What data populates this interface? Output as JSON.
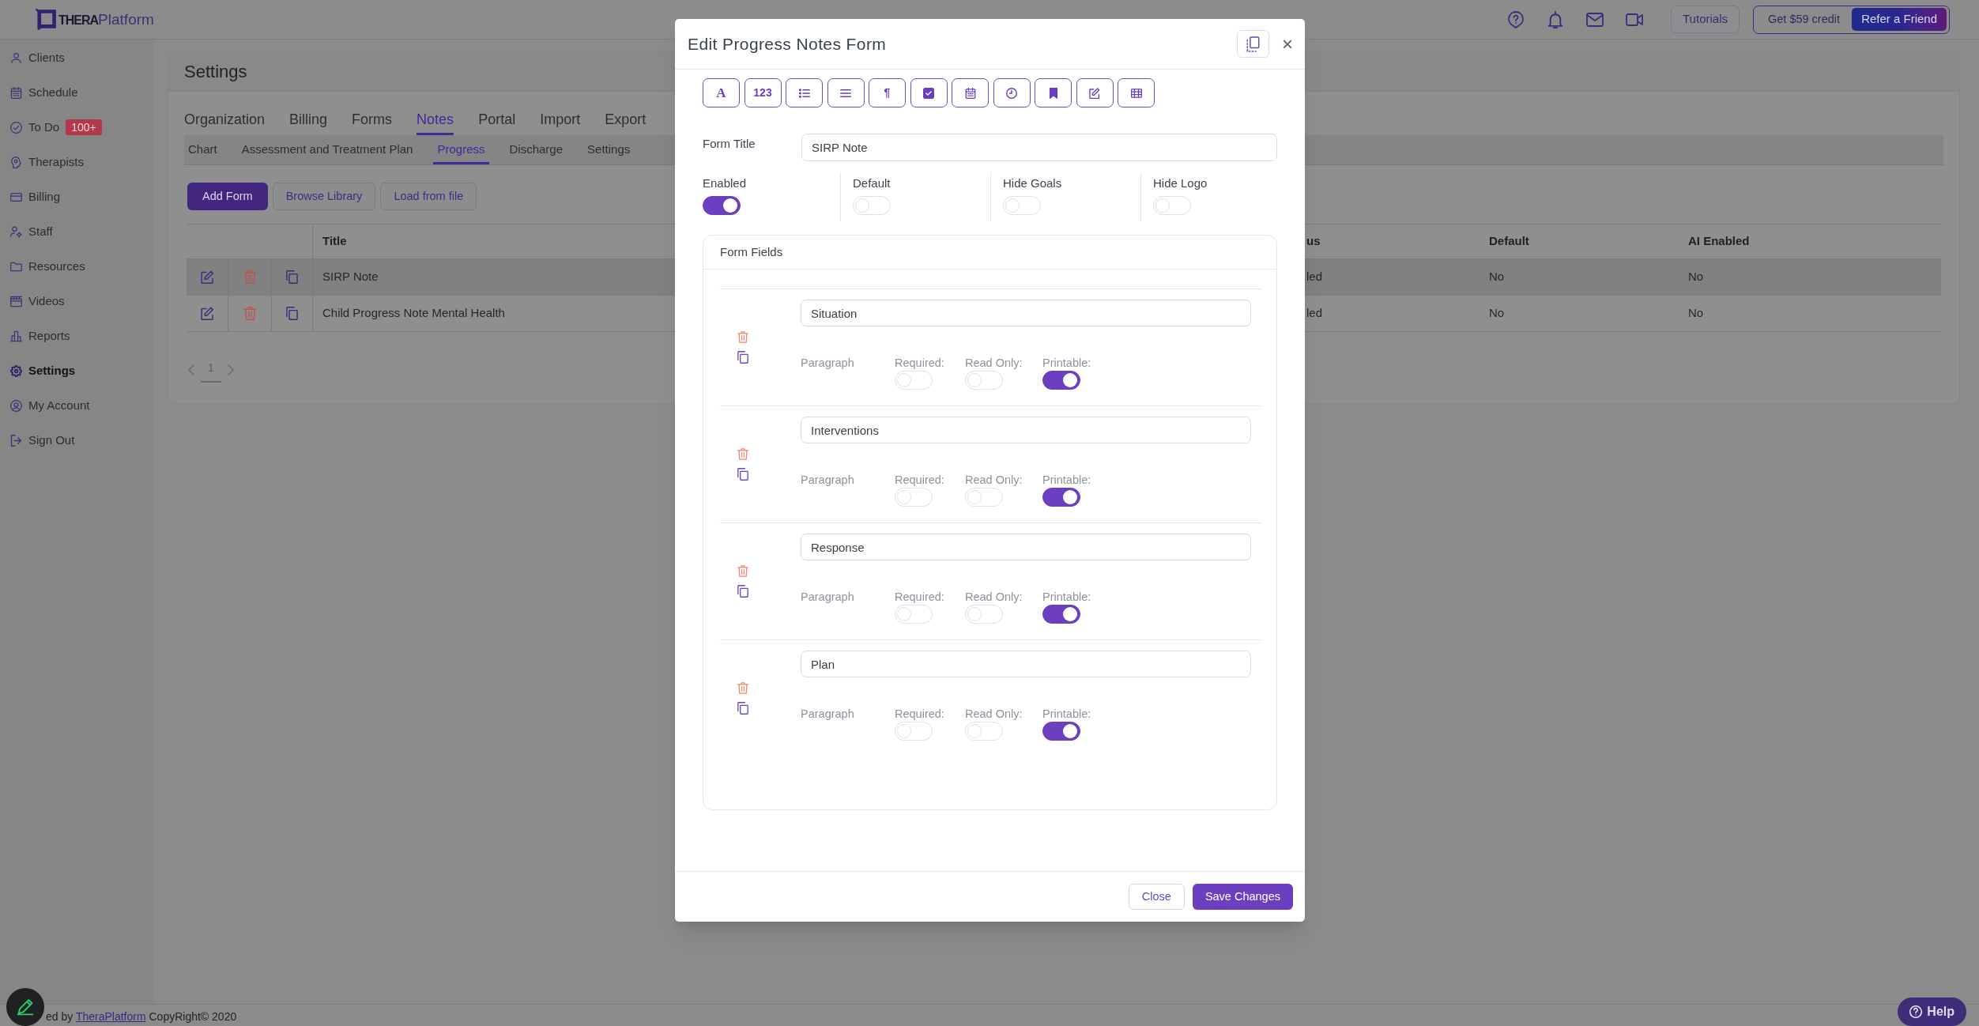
{
  "header": {
    "logo": {
      "bold": "THERA",
      "light": "Platform"
    },
    "buttons": [
      {
        "label": "Tutorials"
      }
    ],
    "credit": {
      "label": "Get $59 credit",
      "button": "Refer a Friend"
    }
  },
  "sidebar": {
    "items": [
      {
        "label": "Clients",
        "selected": false
      },
      {
        "label": "Schedule",
        "selected": false
      },
      {
        "label": "To Do",
        "selected": false,
        "badge": "100+"
      },
      {
        "label": "Therapists",
        "selected": false
      },
      {
        "label": "Billing",
        "selected": false
      },
      {
        "label": "Staff",
        "selected": false
      },
      {
        "label": "Resources",
        "selected": false
      },
      {
        "label": "Videos",
        "selected": false
      },
      {
        "label": "Reports",
        "selected": false
      },
      {
        "label": "Settings",
        "selected": true
      },
      {
        "label": "My Account",
        "selected": false
      },
      {
        "label": "Sign Out",
        "selected": false
      }
    ]
  },
  "settings": {
    "title": "Settings",
    "tabs": [
      {
        "label": "Organization",
        "selected": false
      },
      {
        "label": "Billing",
        "selected": false
      },
      {
        "label": "Forms",
        "selected": false
      },
      {
        "label": "Notes",
        "selected": true
      },
      {
        "label": "Portal",
        "selected": false
      },
      {
        "label": "Import",
        "selected": false
      },
      {
        "label": "Export",
        "selected": false
      }
    ],
    "subtabs": [
      {
        "label": "Chart",
        "selected": false
      },
      {
        "label": "Assessment and Treatment Plan",
        "selected": false
      },
      {
        "label": "Progress",
        "selected": true
      },
      {
        "label": "Discharge",
        "selected": false
      },
      {
        "label": "Settings",
        "selected": false
      }
    ],
    "actions": [
      {
        "label": "Add Form",
        "kind": "primary"
      },
      {
        "label": "Browse Library",
        "kind": "secondary"
      },
      {
        "label": "Load from file",
        "kind": "secondary"
      }
    ],
    "table": {
      "columns": [
        "Title",
        "us",
        "Default",
        "AI Enabled"
      ],
      "rows": [
        {
          "selected": true,
          "cells": [
            "SIRP Note",
            "led",
            "No",
            "No"
          ]
        },
        {
          "selected": false,
          "cells": [
            "Child Progress Note Mental Health",
            "led",
            "No",
            "No"
          ]
        }
      ]
    },
    "pagination": {
      "current": "1"
    }
  },
  "modal": {
    "title": "Edit Progress Notes Form",
    "close": "×",
    "toolbar": [
      {
        "kind": "serif",
        "label": "A"
      },
      {
        "kind": "text",
        "label": "123"
      },
      {
        "kind": "icon"
      },
      {
        "kind": "icon"
      },
      {
        "kind": "text",
        "label": "¶"
      },
      {
        "kind": "icon"
      },
      {
        "kind": "icon"
      },
      {
        "kind": "icon"
      },
      {
        "kind": "icon"
      },
      {
        "kind": "icon"
      },
      {
        "kind": "icon"
      }
    ],
    "form_title": {
      "label": "Form Title",
      "value": "SIRP Note"
    },
    "switches": [
      {
        "label": "Enabled",
        "on": true
      },
      {
        "label": "Default",
        "on": false
      },
      {
        "label": "Hide Goals",
        "on": false
      },
      {
        "label": "Hide Logo",
        "on": false
      }
    ],
    "fields_panel": {
      "title": "Form Fields",
      "fields": [
        {
          "name": "Situation",
          "type": "Paragraph",
          "options": [
            {
              "label": "Required:",
              "on": false
            },
            {
              "label": "Read Only:",
              "on": false
            },
            {
              "label": "Printable:",
              "on": true
            }
          ]
        },
        {
          "name": "Interventions",
          "type": "Paragraph",
          "options": [
            {
              "label": "Required:",
              "on": false
            },
            {
              "label": "Read Only:",
              "on": false
            },
            {
              "label": "Printable:",
              "on": true
            }
          ]
        },
        {
          "name": "Response",
          "type": "Paragraph",
          "options": [
            {
              "label": "Required:",
              "on": false
            },
            {
              "label": "Read Only:",
              "on": false
            },
            {
              "label": "Printable:",
              "on": true
            }
          ]
        },
        {
          "name": "Plan",
          "type": "Paragraph",
          "options": [
            {
              "label": "Required:",
              "on": false
            },
            {
              "label": "Read Only:",
              "on": false
            },
            {
              "label": "Printable:",
              "on": true
            }
          ]
        }
      ]
    },
    "buttons": [
      {
        "label": "Close",
        "kind": "secondary"
      },
      {
        "label": "Save Changes",
        "kind": "primary"
      }
    ]
  },
  "footer": {
    "before": "ed by",
    "link": "TheraPlatform",
    "after": "CopyRight© 2020"
  },
  "help_button": {
    "label": "Help"
  }
}
